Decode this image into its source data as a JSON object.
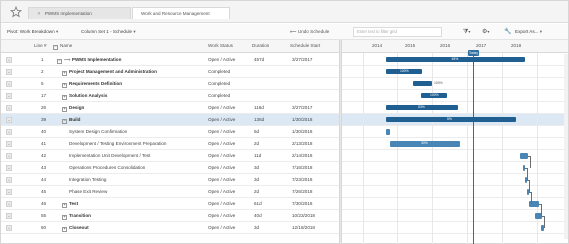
{
  "tabs": [
    {
      "label": "PWMS Implementation"
    },
    {
      "label": "Work and Resource Management"
    }
  ],
  "toolbar": {
    "pivot": "Pivot: Work Breakdown",
    "column_set": "Column Set 1 - Schedule",
    "undo": "Undo Schedule",
    "search_placeholder": "Enter text to filter grid",
    "export": "Export As..."
  },
  "columns": {
    "line": "Line #",
    "name": "Name",
    "status": "Work Status",
    "duration": "Duration",
    "start": "Schedule Start"
  },
  "gantt": {
    "years": [
      "2014",
      "2015",
      "2016",
      "2017",
      "2018"
    ],
    "today_label": "Today"
  },
  "rows": [
    {
      "line": "1",
      "name": "PWMS Implementation",
      "status": "Open / Active",
      "duration": "457d",
      "start": "3/27/2017",
      "bold": true,
      "pct": "45%"
    },
    {
      "line": "2",
      "name": "Project Management and Administration",
      "status": "Completed",
      "duration": "",
      "start": "",
      "bold": true,
      "pct": "100%"
    },
    {
      "line": "5",
      "name": "Requirements Definition",
      "status": "Completed",
      "duration": "",
      "start": "",
      "bold": true,
      "pct": "100%"
    },
    {
      "line": "17",
      "name": "Solution Analysis",
      "status": "Completed",
      "duration": "",
      "start": "",
      "bold": true,
      "pct": "100%"
    },
    {
      "line": "26",
      "name": "Design",
      "status": "Open / Active",
      "duration": "116d",
      "start": "3/27/2017",
      "bold": true,
      "pct": "53%"
    },
    {
      "line": "39",
      "name": "Build",
      "status": "Open / Active",
      "duration": "136d",
      "start": "1/30/2018",
      "bold": true,
      "pct": "5%"
    },
    {
      "line": "40",
      "name": "System Design Confirmation",
      "status": "Open / Active",
      "duration": "5d",
      "start": "1/30/2018",
      "bold": false,
      "pct": ""
    },
    {
      "line": "41",
      "name": "Development / Testing Environment Preparation",
      "status": "Open / Active",
      "duration": "2d",
      "start": "2/13/2018",
      "bold": false,
      "pct": "30%"
    },
    {
      "line": "42",
      "name": "Implementation Unit Development / Test",
      "status": "Open / Active",
      "duration": "11d",
      "start": "2/14/2018",
      "bold": false,
      "pct": ""
    },
    {
      "line": "43",
      "name": "Operations Procedures Consolidation",
      "status": "Open / Active",
      "duration": "3d",
      "start": "7/16/2018",
      "bold": false,
      "pct": ""
    },
    {
      "line": "44",
      "name": "Integration Testing",
      "status": "Open / Active",
      "duration": "3d",
      "start": "7/23/2018",
      "bold": false,
      "pct": ""
    },
    {
      "line": "45",
      "name": "Phase Exit Review",
      "status": "Open / Active",
      "duration": "2d",
      "start": "7/26/2018",
      "bold": false,
      "pct": ""
    },
    {
      "line": "46",
      "name": "Test",
      "status": "Open / Active",
      "duration": "61d",
      "start": "7/30/2018",
      "bold": true,
      "pct": ""
    },
    {
      "line": "55",
      "name": "Transition",
      "status": "Open / Active",
      "duration": "40d",
      "start": "10/23/2018",
      "bold": true,
      "pct": ""
    },
    {
      "line": "60",
      "name": "Closeout",
      "status": "Open / Active",
      "duration": "3d",
      "start": "12/18/2018",
      "bold": true,
      "pct": ""
    }
  ]
}
